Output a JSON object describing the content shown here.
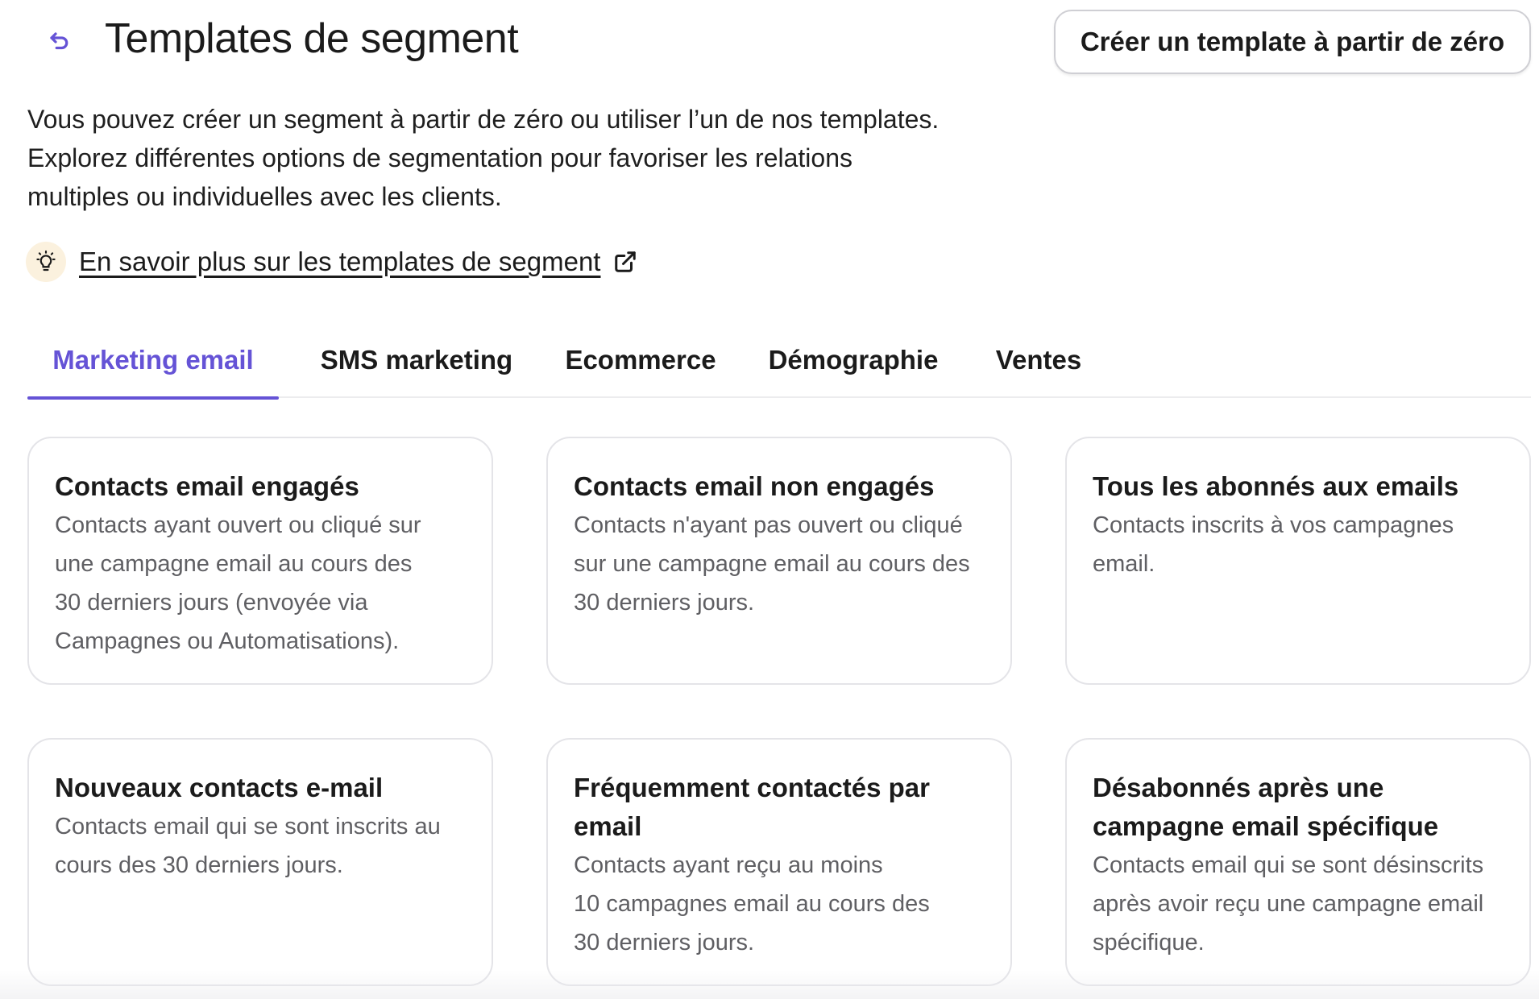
{
  "header": {
    "title": "Templates de segment",
    "create_button_label": "Créer un template à partir de zéro"
  },
  "intro": {
    "lines": [
      "Vous pouvez créer un segment à partir de zéro ou utiliser l’un de nos templates.",
      "Explorez différentes options de segmentation pour favoriser les relations",
      "multiples ou individuelles avec les clients."
    ],
    "learn_more_label": "En savoir plus sur les templates de segment"
  },
  "tabs": [
    {
      "label": "Marketing email",
      "active": true
    },
    {
      "label": "SMS marketing",
      "active": false
    },
    {
      "label": "Ecommerce",
      "active": false
    },
    {
      "label": "Démographie",
      "active": false
    },
    {
      "label": "Ventes",
      "active": false
    }
  ],
  "cards": [
    {
      "title_lines": [
        "Contacts email engagés"
      ],
      "desc_lines": [
        "Contacts ayant ouvert ou cliqué sur",
        "une campagne email au cours des",
        "30 derniers jours (envoyée via",
        "Campagnes ou Automatisations)."
      ]
    },
    {
      "title_lines": [
        "Contacts email non engagés"
      ],
      "desc_lines": [
        "Contacts n'ayant pas ouvert ou cliqué",
        "sur une campagne email au cours des",
        "30 derniers jours."
      ]
    },
    {
      "title_lines": [
        "Tous les abonnés aux emails"
      ],
      "desc_lines": [
        "Contacts inscrits à vos campagnes",
        "email."
      ]
    },
    {
      "title_lines": [
        "Nouveaux contacts e-mail"
      ],
      "desc_lines": [
        "Contacts email qui se sont inscrits au",
        "cours des 30 derniers jours."
      ]
    },
    {
      "title_lines": [
        "Fréquemment contactés par",
        "email"
      ],
      "desc_lines": [
        "Contacts ayant reçu au moins",
        "10 campagnes email au cours des",
        "30 derniers jours."
      ]
    },
    {
      "title_lines": [
        "Désabonnés après une",
        "campagne email spécifique"
      ],
      "desc_lines": [
        "Contacts email qui se sont désinscrits",
        "après avoir reçu une campagne email",
        "spécifique."
      ]
    }
  ],
  "colors": {
    "accent": "#6553d6",
    "text": "#1b1b1b",
    "muted_text": "#5f5f63",
    "card_border": "#e4e4e8",
    "bulb_bg": "#fbf1de"
  },
  "icons": {
    "back": "undo-arrow-icon",
    "bulb": "lightbulb-icon",
    "external": "external-link-icon"
  }
}
